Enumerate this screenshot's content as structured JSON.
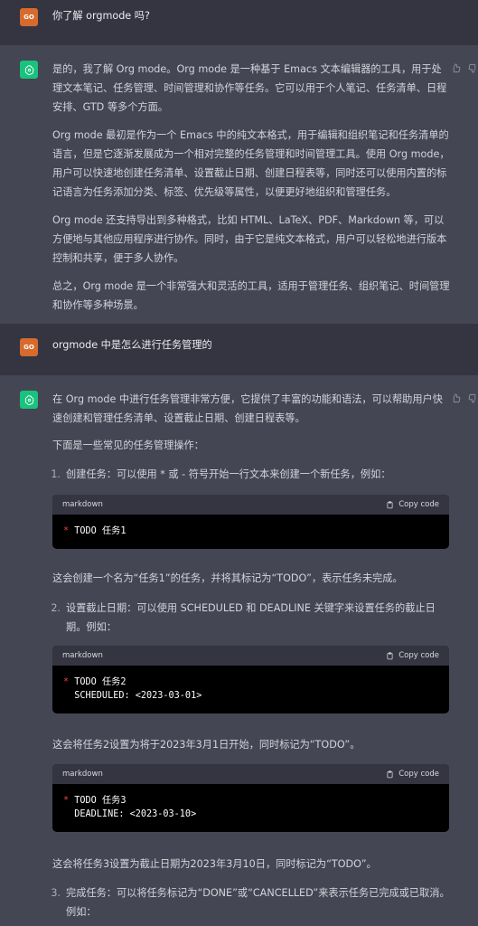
{
  "avatar": {
    "user_label": "GO"
  },
  "copy_label": "Copy code",
  "messages": [
    {
      "role": "user",
      "text": "你了解 orgmode 吗?"
    },
    {
      "role": "assistant",
      "paragraphs": [
        "是的，我了解 Org mode。Org mode 是一种基于 Emacs 文本编辑器的工具，用于处理文本笔记、任务管理、时间管理和协作等任务。它可以用于个人笔记、任务清单、日程安排、GTD 等多个方面。",
        "Org mode 最初是作为一个 Emacs 中的纯文本格式，用于编辑和组织笔记和任务清单的语言，但是它逐渐发展成为一个相对完整的任务管理和时间管理工具。使用 Org mode，用户可以快速地创建任务清单、设置截止日期、创建日程表等，同时还可以使用内置的标记语言为任务添加分类、标签、优先级等属性，以便更好地组织和管理任务。",
        "Org mode 还支持导出到多种格式，比如 HTML、LaTeX、PDF、Markdown 等，可以方便地与其他应用程序进行协作。同时，由于它是纯文本格式，用户可以轻松地进行版本控制和共享，便于多人协作。",
        "总之，Org mode 是一个非常强大和灵活的工具，适用于管理任务、组织笔记、时间管理和协作等多种场景。"
      ]
    },
    {
      "role": "user",
      "text": "orgmode 中是怎么进行任务管理的"
    },
    {
      "role": "assistant",
      "intro": "在 Org mode 中进行任务管理非常方便，它提供了丰富的功能和语法，可以帮助用户快速创建和管理任务清单、设置截止日期、创建日程表等。",
      "lead": "下面是一些常见的任务管理操作：",
      "items": [
        {
          "num": "1.",
          "text": "创建任务：可以使用 * 或 - 符号开始一行文本来创建一个新任务，例如："
        },
        {
          "num": "2.",
          "text": "设置截止日期：可以使用 SCHEDULED 和 DEADLINE 关键字来设置任务的截止日期。例如："
        },
        {
          "num": "3.",
          "text": "完成任务：可以将任务标记为“DONE”或“CANCELLED”来表示任务已完成或已取消。例如："
        }
      ],
      "code_blocks": [
        {
          "lang": "markdown",
          "bullet": "*",
          "lines": [
            "TODO 任务1"
          ]
        },
        {
          "lang": "markdown",
          "bullet": "*",
          "lines": [
            "TODO 任务2",
            "  SCHEDULED: <2023-03-01>"
          ]
        },
        {
          "lang": "markdown",
          "bullet": "*",
          "lines": [
            "TODO 任务3",
            "  DEADLINE: <2023-03-10>"
          ]
        }
      ],
      "notes": [
        "这会创建一个名为“任务1”的任务，并将其标记为“TODO”，表示任务未完成。",
        "这会将任务2设置为将于2023年3月1日开始，同时标记为“TODO”。",
        "这会将任务3设置为截止日期为2023年3月10日，同时标记为“TODO”。"
      ]
    }
  ]
}
